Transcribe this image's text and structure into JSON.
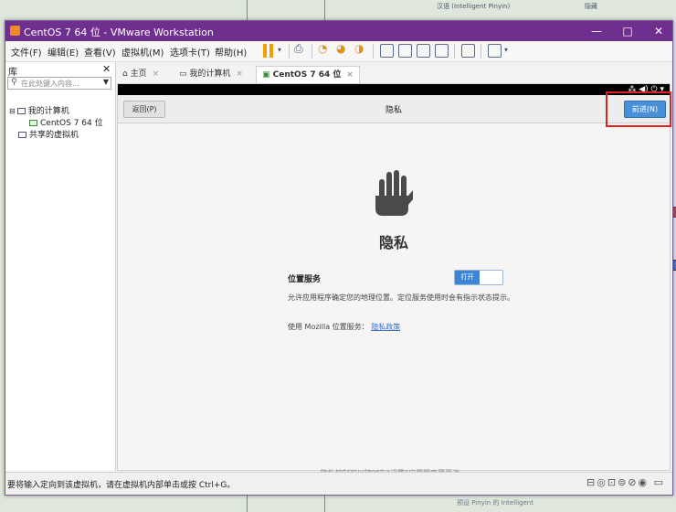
{
  "window": {
    "title": "CentOS 7 64 位 - VMware Workstation",
    "minimize": "—",
    "maximize": "□",
    "close": "✕"
  },
  "background": {
    "top_text": "汉语 (Intelligent Pinyin)",
    "top_text2": "隐藏",
    "bottom_text": "预设 Pinyin 的 Intelligent"
  },
  "menu": {
    "file": "文件(F)",
    "edit": "编辑(E)",
    "view": "查看(V)",
    "vm": "虚拟机(M)",
    "tabs": "选项卡(T)",
    "help": "帮助(H)"
  },
  "library": {
    "title": "库",
    "close": "✕",
    "search_placeholder": "在此处键入内容...",
    "my_computer": "我的计算机",
    "vm_name": "CentOS 7 64 位",
    "shared": "共享的虚拟机"
  },
  "tabs": {
    "home": "主页",
    "my_computer": "我的计算机",
    "vm": "CentOS 7 64 位"
  },
  "guest": {
    "status_icons": "⁂ ◀) ⏻ ▾",
    "back_button": "返回(P)",
    "header_title": "隐私",
    "next_button": "前进(N)",
    "heading": "隐私",
    "location_label": "位置服务",
    "toggle_on": "打开",
    "location_desc": "允许应用程序确定您的地理位置。定位服务使用时会有指示状态提示。",
    "mozilla_prefix": "使用 Mozilla 位置服务：",
    "mozilla_link": "隐私政策",
    "footer": "隐私控制可以随时在“设置”应用程序里更改。"
  },
  "status": {
    "text": "要将输入定向到该虚拟机，请在虚拟机内部单击或按 Ctrl+G。"
  },
  "colors": {
    "titlebar": "#6f2f8f",
    "next_button": "#4a90d9",
    "highlight": "#e02020"
  }
}
